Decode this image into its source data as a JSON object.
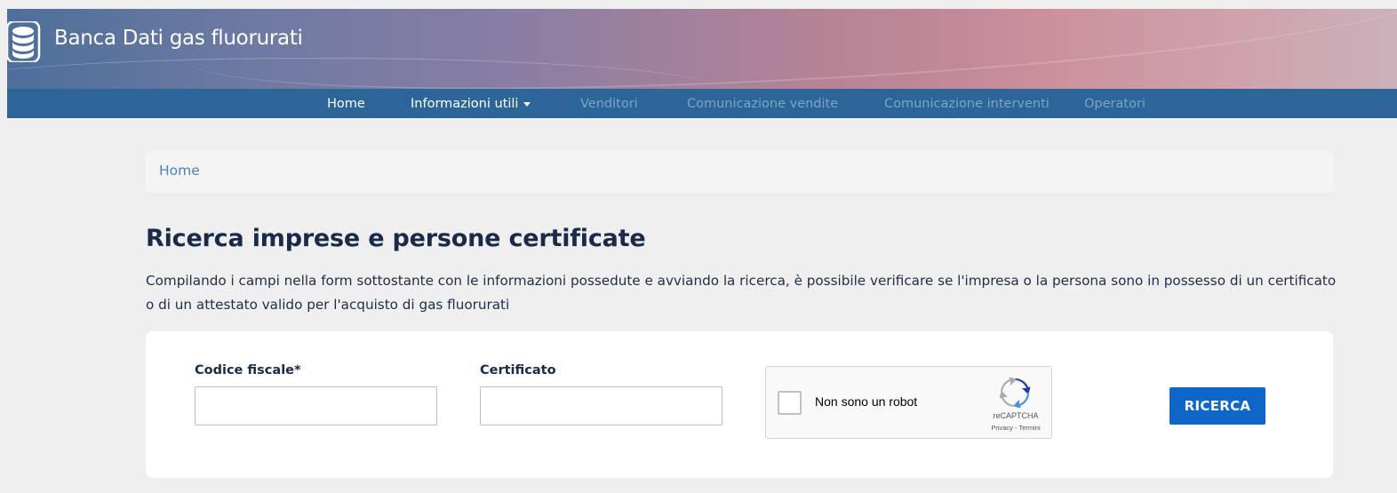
{
  "site": {
    "title": "Banca Dati gas fluorurati",
    "logo_icon": "database-icon"
  },
  "nav": {
    "items": [
      {
        "label": "Home",
        "state": "active"
      },
      {
        "label": "Informazioni utili",
        "state": "dropdown"
      },
      {
        "label": "Venditori",
        "state": "disabled"
      },
      {
        "label": "Comunicazione vendite",
        "state": "disabled"
      },
      {
        "label": "Comunicazione interventi",
        "state": "disabled"
      },
      {
        "label": "Operatori",
        "state": "disabled"
      }
    ]
  },
  "breadcrumb": {
    "home": "Home"
  },
  "page": {
    "title": "Ricerca imprese e persone certificate",
    "intro": "Compilando i campi nella form sottostante con le informazioni possedute e avviando la ricerca, è possibile verificare se l'impresa o la persona sono in possesso di un certificato o di un attestato valido per l'acquisto di gas fluorurati"
  },
  "form": {
    "codice_fiscale": {
      "label": "Codice fiscale*",
      "value": ""
    },
    "certificato": {
      "label": "Certificato",
      "value": ""
    },
    "captcha": {
      "label": "Non sono un robot",
      "brand": "reCAPTCHA",
      "links": "Privacy - Termini",
      "checked": false
    },
    "submit_label": "RICERCA"
  },
  "colors": {
    "navbar": "#2c6698",
    "nav_disabled": "#7ea3c8",
    "link": "#4b82be",
    "title": "#1a2b4a",
    "button": "#0d66c8",
    "page_bg": "#efefef"
  }
}
